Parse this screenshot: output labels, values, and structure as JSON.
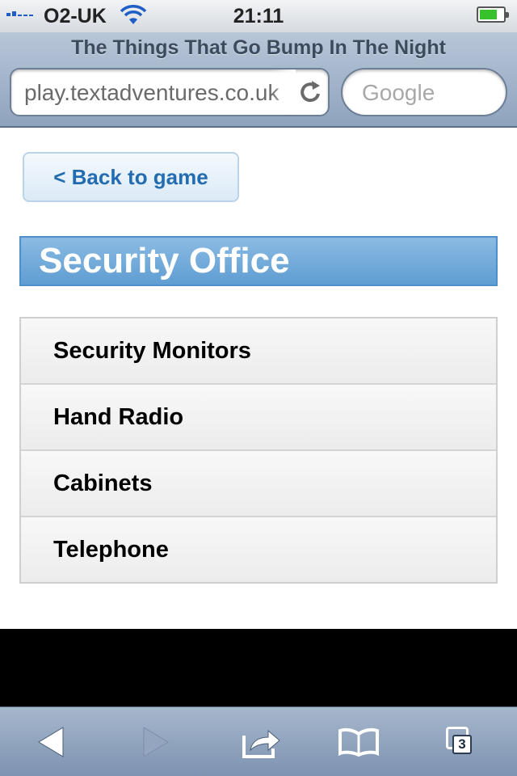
{
  "status_bar": {
    "carrier": "O2-UK",
    "time": "21:11",
    "battery_level": 0.75,
    "signal_bars": 2
  },
  "browser": {
    "page_title": "The Things That Go Bump In The Night",
    "url": "play.textadventures.co.uk",
    "search_placeholder": "Google",
    "tab_count": "3"
  },
  "page": {
    "back_button": "< Back to game",
    "section_title": "Security Office",
    "items": [
      {
        "label": "Security Monitors"
      },
      {
        "label": "Hand Radio"
      },
      {
        "label": "Cabinets"
      },
      {
        "label": "Telephone"
      }
    ]
  },
  "colors": {
    "header_blue": "#6aa6d8",
    "link_blue": "#246cb0",
    "toolbar": "#8fa3bd"
  },
  "icons": {
    "back": "back-arrow-icon",
    "forward": "forward-arrow-icon",
    "share": "share-icon",
    "bookmarks": "bookmarks-icon",
    "tabs": "tabs-icon",
    "reload": "reload-icon",
    "wifi": "wifi-icon"
  }
}
